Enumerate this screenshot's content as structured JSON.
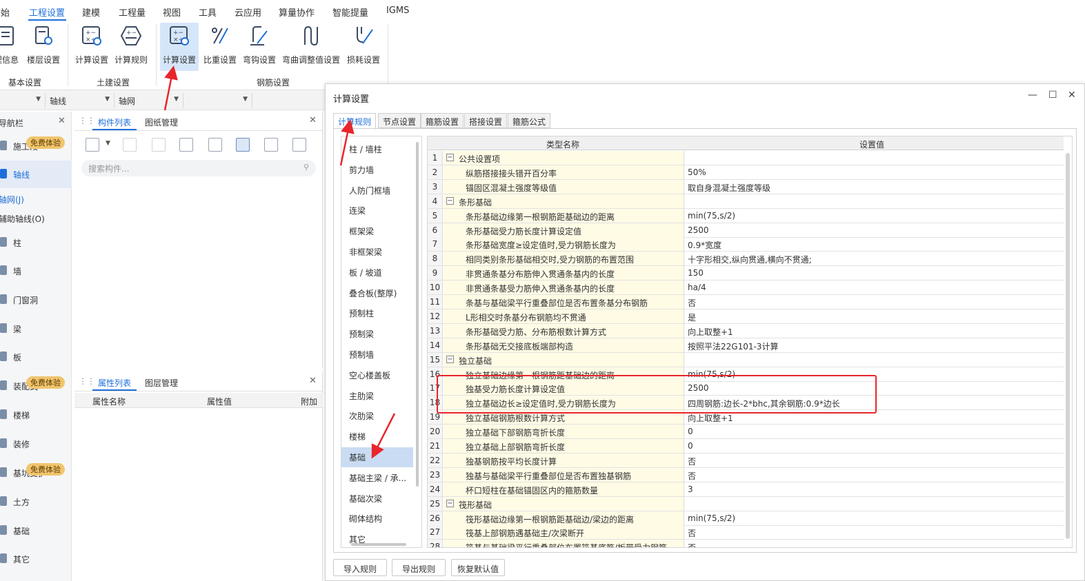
{
  "menubar": {
    "items": [
      "开始",
      "工程设置",
      "建模",
      "工程量",
      "视图",
      "工具",
      "云应用",
      "算量协作",
      "智能提量",
      "IGMS"
    ],
    "active_index": 1
  },
  "ribbon": {
    "groups": [
      {
        "label": "基本设置",
        "buttons": [
          "工程信息",
          "楼层设置"
        ]
      },
      {
        "label": "土建设置",
        "buttons": [
          "计算设置",
          "计算规则"
        ]
      },
      {
        "label": "钢筋设置",
        "buttons": [
          "计算设置",
          "比重设置",
          "弯钩设置",
          "弯曲调整值设置",
          "损耗设置"
        ]
      }
    ],
    "first_button_visible_text": "程信息"
  },
  "combos": {
    "first": "",
    "second": "轴线",
    "third": "轴网",
    "fourth": ""
  },
  "leftnav": {
    "title": "导航栏",
    "close": "✕",
    "items": [
      "施工段",
      "轴线",
      "柱",
      "墙",
      "门窗洞",
      "梁",
      "板",
      "装配式",
      "楼梯",
      "装修",
      "基坑支护",
      "土方",
      "基础",
      "其它"
    ],
    "visible_labels": [
      "施工段",
      "轴线",
      "柱",
      "墙",
      "门窗洞",
      "梁",
      "板",
      "装配式",
      "楼梯",
      "装修",
      "基坑支护",
      "土方",
      "基础",
      "其它"
    ],
    "sub_items": [
      "轴网(J)",
      "辅助轴线(O)"
    ],
    "badge": "免费体验",
    "selected": "轴线"
  },
  "component_panel": {
    "tabs": [
      "构件列表",
      "图纸管理"
    ],
    "active_tab": "构件列表",
    "search_placeholder": "搜索构件..."
  },
  "property_panel": {
    "tabs": [
      "属性列表",
      "图层管理"
    ],
    "active_tab": "属性列表",
    "columns": [
      "属性名称",
      "属性值",
      "附加"
    ]
  },
  "dialog": {
    "title": "计算设置",
    "tabs": [
      "计算规则",
      "节点设置",
      "箍筋设置",
      "搭接设置",
      "箍筋公式"
    ],
    "active_tab": "计算规则",
    "categories": [
      "柱 / 墙柱",
      "剪力墙",
      "人防门框墙",
      "连梁",
      "框架梁",
      "非框架梁",
      "板 / 坡道",
      "叠合板(整厚)",
      "预制柱",
      "预制梁",
      "预制墙",
      "空心楼盖板",
      "主肋梁",
      "次肋梁",
      "楼梯",
      "基础",
      "基础主梁 / 承...",
      "基础次梁",
      "砌体结构",
      "其它"
    ],
    "selected_category": "基础",
    "grid_headers": [
      "类型名称",
      "设置值"
    ],
    "rows": [
      {
        "n": "1",
        "type": "group",
        "name": "公共设置项",
        "value": ""
      },
      {
        "n": "2",
        "type": "item",
        "name": "纵筋搭接接头错开百分率",
        "value": "50%"
      },
      {
        "n": "3",
        "type": "item",
        "name": "锚固区混凝土强度等级值",
        "value": "取自身混凝土强度等级"
      },
      {
        "n": "4",
        "type": "group",
        "name": "条形基础",
        "value": ""
      },
      {
        "n": "5",
        "type": "item",
        "name": "条形基础边缘第一根钢筋距基础边的距离",
        "value": "min(75,s/2)"
      },
      {
        "n": "6",
        "type": "item",
        "name": "条形基础受力筋长度计算设定值",
        "value": "2500"
      },
      {
        "n": "7",
        "type": "item",
        "name": "条形基础宽度≥设定值时,受力钢筋长度为",
        "value": "0.9*宽度"
      },
      {
        "n": "8",
        "type": "item",
        "name": "相同类别条形基础相交时,受力钢筋的布置范围",
        "value": "十字形相交,纵向贯通,横向不贯通;"
      },
      {
        "n": "9",
        "type": "item",
        "name": "非贯通条基分布筋伸入贯通条基内的长度",
        "value": "150"
      },
      {
        "n": "10",
        "type": "item",
        "name": "非贯通条基受力筋伸入贯通条基内的长度",
        "value": "ha/4"
      },
      {
        "n": "11",
        "type": "item",
        "name": "条基与基础梁平行重叠部位是否布置条基分布钢筋",
        "value": "否"
      },
      {
        "n": "12",
        "type": "item",
        "name": "L形相交时条基分布钢筋均不贯通",
        "value": "是"
      },
      {
        "n": "13",
        "type": "item",
        "name": "条形基础受力筋、分布筋根数计算方式",
        "value": "向上取整+1"
      },
      {
        "n": "14",
        "type": "item",
        "name": "条形基础无交接底板端部构造",
        "value": "按照平法22G101-3计算"
      },
      {
        "n": "15",
        "type": "group",
        "name": "独立基础",
        "value": ""
      },
      {
        "n": "16",
        "type": "item",
        "name": "独立基础边缘第一根钢筋距基础边的距离",
        "value": "min(75,s/2)"
      },
      {
        "n": "17",
        "type": "item",
        "name": "独基受力筋长度计算设定值",
        "value": "2500"
      },
      {
        "n": "18",
        "type": "item",
        "name": "独立基础边长≥设定值时,受力钢筋长度为",
        "value": "四周钢筋:边长-2*bhc,其余钢筋:0.9*边长"
      },
      {
        "n": "19",
        "type": "item",
        "name": "独立基础钢筋根数计算方式",
        "value": "向上取整+1"
      },
      {
        "n": "20",
        "type": "item",
        "name": "独立基础下部钢筋弯折长度",
        "value": "0"
      },
      {
        "n": "21",
        "type": "item",
        "name": "独立基础上部钢筋弯折长度",
        "value": "0"
      },
      {
        "n": "22",
        "type": "item",
        "name": "独基钢筋按平均长度计算",
        "value": "否"
      },
      {
        "n": "23",
        "type": "item",
        "name": "独基与基础梁平行重叠部位是否布置独基钢筋",
        "value": "否"
      },
      {
        "n": "24",
        "type": "item",
        "name": "杯口短柱在基础锚固区内的箍筋数量",
        "value": "3"
      },
      {
        "n": "25",
        "type": "group",
        "name": "筏形基础",
        "value": ""
      },
      {
        "n": "26",
        "type": "item",
        "name": "筏形基础边缘第一根钢筋距基础边/梁边的距离",
        "value": "min(75,s/2)"
      },
      {
        "n": "27",
        "type": "item",
        "name": "筏基上部钢筋遇基础主/次梁断开",
        "value": "否"
      },
      {
        "n": "28",
        "type": "item",
        "name": "筏基与基础梁平行重叠部位布置筏基底筋/板带受力钢筋",
        "value": "否"
      }
    ],
    "buttons": [
      "导入规则",
      "导出规则",
      "恢复默认值"
    ],
    "window_controls": [
      "—",
      "☐",
      "✕"
    ]
  },
  "colors": {
    "accent": "#1e6fd9",
    "annotation": "#e8262b",
    "name_cell_bg": "#fffbe5",
    "selected_bg": "#c9dcf3",
    "badge_bg": "#f1c56e"
  }
}
